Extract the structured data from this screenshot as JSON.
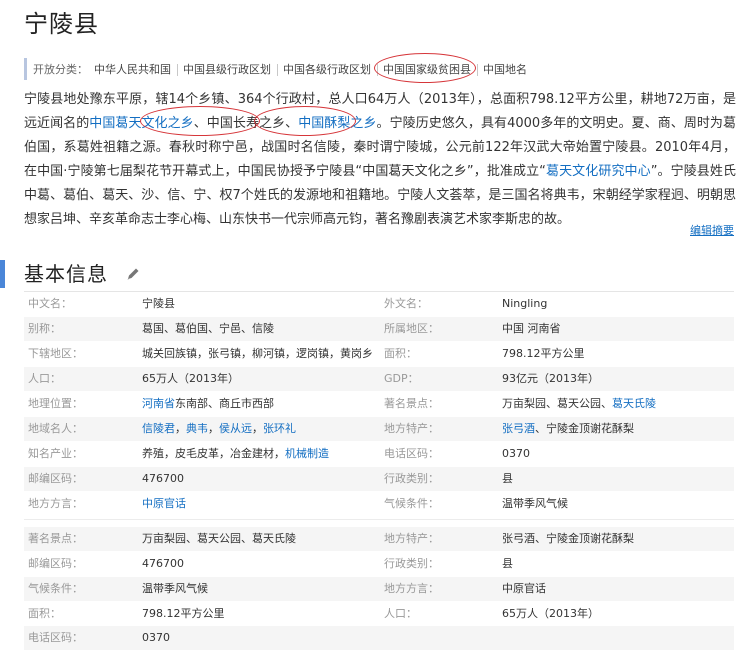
{
  "page_title": "宁陵县",
  "categories": {
    "label": "开放分类：",
    "items": [
      "中华人民共和国",
      "中国县级行政区划",
      "中国各级行政区划",
      "中国国家级贫困县",
      "中国地名"
    ]
  },
  "summary": {
    "p1": "宁陵县地处豫东平原，辖14个乡镇、364个行政村，总人口64万人（2013年），总面积798.12平方公里，耕地72万亩，是远近闻名的",
    "link1": "中国葛天文化之乡",
    "p2": "、中国长寿之乡、",
    "link2": "中国酥梨之乡",
    "p3": "。宁陵历史悠久，具有4000多年的文明史。夏、商、周时为葛伯国，系葛姓祖籍之源。春秋时称宁邑，战国时名信陵，秦时谓宁陵城，公元前122年汉武大帝始置宁陵县。2010年4月，在中国·宁陵第七届梨花节开幕式上，中国民协授予宁陵县“中国葛天文化之乡”，批准成立“",
    "link3": "葛天文化研究中心",
    "p4": "”。宁陵县姓氏中葛、葛伯、葛天、沙、信、宁、权7个姓氏的发源地和祖籍地。宁陵人文荟萃，是三国名将典韦，宋朝经学家程迥、明朝思想家吕坤、辛亥革命志士李心梅、山东快书一代宗师高元钧，著名豫剧表演艺术家李斯忠的故。"
  },
  "edit_summary": "编辑摘要",
  "section_title": "基本信息",
  "info_rows": [
    {
      "k1": "中文名：",
      "v1": "宁陵县",
      "k2": "外文名：",
      "v2": "Ningling"
    },
    {
      "k1": "别称：",
      "v1": "葛国、葛伯国、宁邑、信陵",
      "k2": "所属地区：",
      "v2": "中国 河南省"
    },
    {
      "k1": "下辖地区：",
      "v1": "城关回族镇，张弓镇，柳河镇，逻岗镇，黄岗乡",
      "k2": "面积：",
      "v2": "798.12平方公里"
    },
    {
      "k1": "人口：",
      "v1": "65万人（2013年）",
      "k2": "GDP：",
      "v2": "93亿元（2013年）"
    },
    {
      "k1": "地理位置：",
      "v1a": "河南省",
      "v1b": "东南部、商丘市西部",
      "k2": "著名景点：",
      "v2a": "万亩梨园、葛天公园、",
      "v2b": "葛天氏陵"
    },
    {
      "k1": "地域名人：",
      "v1a": "信陵君",
      "v1s1": "，",
      "v1b": "典韦",
      "v1s2": "，",
      "v1c": "侯从远",
      "v1s3": "，",
      "v1d": "张环礼",
      "k2": "地方特产：",
      "v2a": "张弓酒",
      "v2b": "、宁陵金顶谢花酥梨"
    },
    {
      "k1": "知名产业：",
      "v1a": "养殖，皮毛皮革，冶金建材，",
      "v1b": "机械制造",
      "k2": "电话区码：",
      "v2": "0370"
    },
    {
      "k1": "邮编区码：",
      "v1": "476700",
      "k2": "行政类别：",
      "v2": "县"
    },
    {
      "k1": "地方方言：",
      "v1": "中原官话",
      "k2": "气候条件：",
      "v2": "温带季风气候"
    }
  ],
  "extra_rows": [
    {
      "k1": "著名景点：",
      "v1": "万亩梨园、葛天公园、葛天氏陵",
      "k2": "地方特产：",
      "v2": "张弓酒、宁陵金顶谢花酥梨"
    },
    {
      "k1": "邮编区码：",
      "v1": "476700",
      "k2": "行政类别：",
      "v2": "县"
    },
    {
      "k1": "气候条件：",
      "v1": "温带季风气候",
      "k2": "地方方言：",
      "v2": "中原官话"
    },
    {
      "k1": "面积：",
      "v1": "798.12平方公里",
      "k2": "人口：",
      "v2": "65万人（2013年）"
    },
    {
      "k1": "电话区码：",
      "v1": "0370"
    }
  ],
  "colors": {
    "link": "#136ec2",
    "annotation": "#d6363a",
    "section_bar": "#4a86d8"
  },
  "icons": {
    "edit": "pencil-icon"
  }
}
